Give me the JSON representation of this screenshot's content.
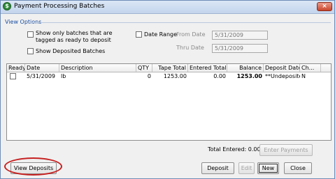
{
  "window": {
    "title": "Payment Processing Batches",
    "close_glyph": "×",
    "app_icon_glyph": "$"
  },
  "view_options": {
    "group_label": "View Options",
    "show_only_line1": "Show only batches that are",
    "show_only_line2": "tagged as ready to deposit",
    "show_deposited": "Show Deposited Batches",
    "date_range_label": "Date Range",
    "from_label": "From Date",
    "from_value": "5/31/2009",
    "thru_label": "Thru Date",
    "thru_value": "5/31/2009"
  },
  "table": {
    "headers": [
      "Ready",
      "Date",
      "Description",
      "QTY",
      "Tape Total",
      "Entered Total",
      "Balance",
      "Deposit Date",
      "Ch..."
    ],
    "rows": [
      {
        "date": "5/31/2009",
        "description": "lb",
        "qty": "0",
        "tape_total": "1253.00",
        "entered_total": "0.00",
        "balance": "1253.00",
        "deposit_date": "**Undeposite...",
        "ch": "N"
      }
    ]
  },
  "footer": {
    "total_entered": "Total Entered: 0.00",
    "enter_payments": "Enter Payments",
    "view_deposits": "View Deposits",
    "deposit": "Deposit",
    "edit": "Edit",
    "new": "New",
    "close": "Close"
  }
}
